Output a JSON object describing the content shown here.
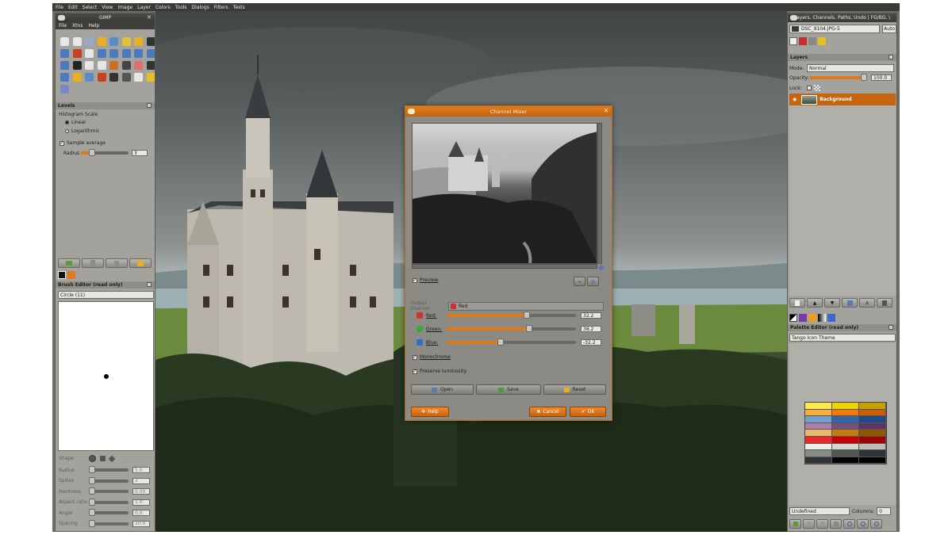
{
  "menubar": {
    "items": [
      "File",
      "Edit",
      "Select",
      "View",
      "Image",
      "Layer",
      "Colors",
      "Tools",
      "Dialogs",
      "Filters",
      "Tests"
    ]
  },
  "toolbox": {
    "title": "GIMP",
    "menu": [
      "File",
      "Xtns",
      "Help"
    ],
    "tool_colors": [
      "#e6e6e6",
      "#e6e6e6",
      "#9aa8c0",
      "#e8b020",
      "#5b8cc8",
      "#e3c23a",
      "#e8b020",
      "#333333",
      "#4a7ac0",
      "#c84020",
      "#e6e6e6",
      "#4a7ac0",
      "#4a7ac0",
      "#4a7ac0",
      "#4a7ac0",
      "#4a7ac0",
      "#4a7ac0",
      "#222222",
      "#e6e6e6",
      "#e6e6e6",
      "#c87020",
      "#444444",
      "#e07070",
      "#333333",
      "#4a7ac0",
      "#e8b020",
      "#5b8cc8",
      "#c84020",
      "#333333",
      "#555555",
      "#e6e6e6",
      "#e8c020",
      "#7a88c8"
    ]
  },
  "levels": {
    "header": "Levels",
    "histogram_label": "Histogram Scale",
    "linear": "Linear",
    "logarithmic": "Logarithmic",
    "sample_average": "Sample average",
    "radius_label": "Radius",
    "radius_value": "3"
  },
  "brush_editor": {
    "header": "Brush Editor (read only)",
    "brush_name": "Circle (11)",
    "shape_label": "Shape",
    "params": [
      {
        "label": "Radius",
        "value": "5.0"
      },
      {
        "label": "Spikes",
        "value": "2"
      },
      {
        "label": "Hardness",
        "value": "0.00"
      },
      {
        "label": "Aspect ratio",
        "value": "1.0"
      },
      {
        "label": "Angle",
        "value": "0.0"
      },
      {
        "label": "Spacing",
        "value": "10.0"
      }
    ]
  },
  "dialog": {
    "title": "Channel Mixer",
    "preview_label": "Preview",
    "output_channel_label": "Output channel:",
    "output_channel_value": "Red",
    "channels": [
      {
        "label": "Red:",
        "value": "32.2",
        "color": "#d43030",
        "level": 0.62
      },
      {
        "label": "Green:",
        "value": "38.2",
        "color": "#3aa838",
        "level": 0.64
      },
      {
        "label": "Blue:",
        "value": "-32.2",
        "color": "#3a6ac8",
        "level": 0.42
      }
    ],
    "monochrome": "Monochrome",
    "preserve_luminosity": "Preserve luminosity",
    "open": "Open",
    "save": "Save",
    "reset": "Reset",
    "help": "Help",
    "cancel": "Cancel",
    "ok": "OK"
  },
  "layers_panel": {
    "title": "Layers, Channels, Paths, Undo | FG/BG, \\",
    "image_name": "DSC_9104.JPG-5",
    "auto": "Auto",
    "header": "Layers",
    "mode_label": "Mode:",
    "mode_value": "Normal",
    "opacity_label": "Opacity:",
    "opacity_value": "100.0",
    "lock_label": "Lock:",
    "layer_name": "Background"
  },
  "palette_editor": {
    "header": "Palette Editor (read only)",
    "palette_name": "Tango Icon Theme",
    "swatches": [
      "#fce94f",
      "#edd400",
      "#c4a000",
      "#fcaf3e",
      "#f57900",
      "#ce5c00",
      "#729fcf",
      "#3465a4",
      "#204a87",
      "#ad7fa8",
      "#75507b",
      "#5c3566",
      "#e9b96e",
      "#c17d11",
      "#8f5902",
      "#ef2929",
      "#cc0000",
      "#a40000",
      "#eeeeec",
      "#d3d7cf",
      "#babdb6",
      "#888a85",
      "#555753",
      "#2e3436",
      "#2e3436",
      "#000000",
      "#000000"
    ],
    "color_name": "Undefined",
    "columns_label": "Columns:",
    "columns_value": "0"
  }
}
